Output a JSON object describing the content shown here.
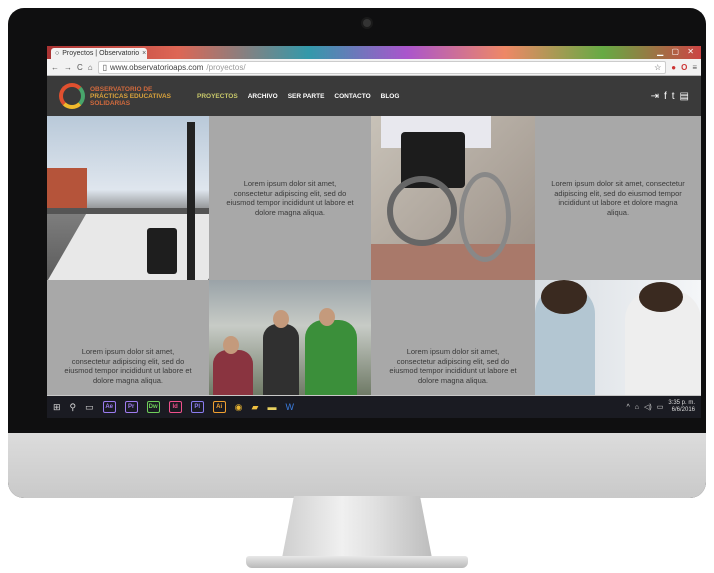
{
  "browser": {
    "tab_title": "Proyectos | Observatorio",
    "tab_close": "×",
    "url_prefix": "www.observatorioaps.com",
    "url_path": "/proyectos/"
  },
  "site": {
    "logo": {
      "line1": "OBSERVATORIO DE",
      "line2": "PRÁCTICAS EDUCATIVAS",
      "line3": "SOLIDARIAS"
    },
    "nav": [
      "PROYECTOS",
      "ARCHIVO",
      "SER PARTE",
      "CONTACTO",
      "BLOG"
    ],
    "lorem": "Lorem ipsum dolor sit amet, consectetur adipiscing elit, sed do eiusmod tempor incididunt ut labore et dolore magna aliqua."
  },
  "taskbar": {
    "apps": [
      {
        "label": "Ae",
        "color": "#9b7cf0"
      },
      {
        "label": "Pr",
        "color": "#a07cf0"
      },
      {
        "label": "Dw",
        "color": "#6fce5a"
      },
      {
        "label": "Id",
        "color": "#f0508c"
      },
      {
        "label": "Pl",
        "color": "#8a7cf0"
      },
      {
        "label": "Ai",
        "color": "#f0a030"
      }
    ],
    "time": "3:35 p. m.",
    "date": "6/6/2016"
  }
}
